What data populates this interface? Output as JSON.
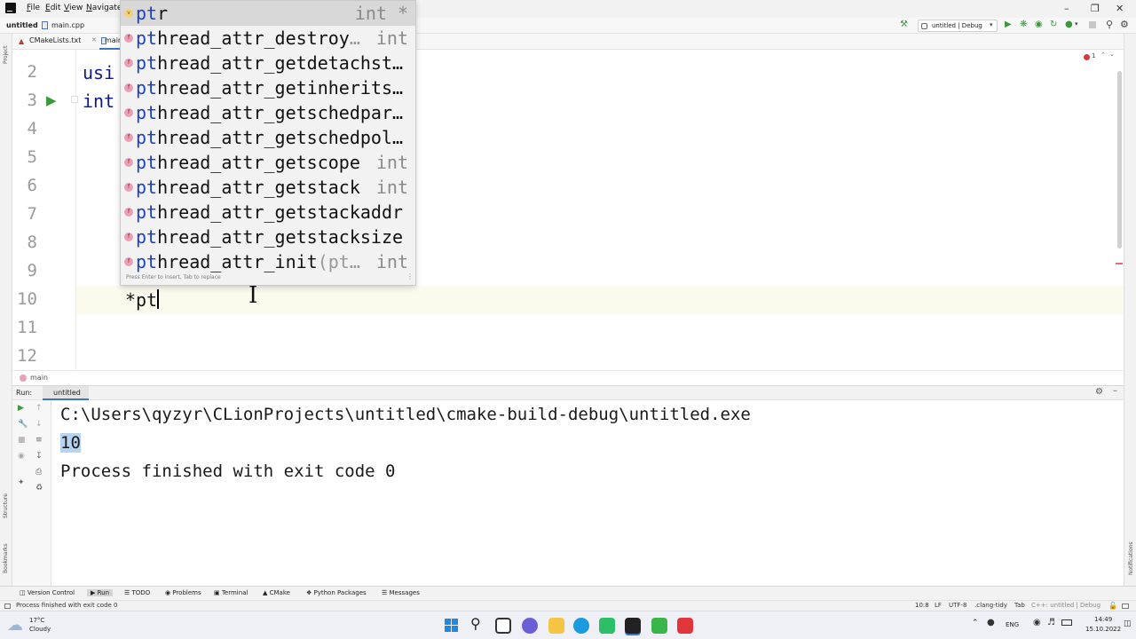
{
  "titlebar": {
    "menu": [
      "File",
      "Edit",
      "View",
      "Navigate"
    ],
    "window_controls": [
      "minimize-icon",
      "restore-icon",
      "close-icon"
    ]
  },
  "navbar": {
    "project": "untitled",
    "file": "main.cpp",
    "config": "untitled | Debug"
  },
  "tabs": [
    {
      "label": "CMakeLists.txt"
    },
    {
      "label": "main"
    }
  ],
  "inspection": {
    "count": "1"
  },
  "editor": {
    "lines": [
      {
        "number": "2",
        "code": "usi"
      },
      {
        "number": "3",
        "code": "int"
      },
      {
        "number": "4",
        "code": ""
      },
      {
        "number": "5",
        "code": ""
      },
      {
        "number": "6",
        "code": ""
      },
      {
        "number": "7",
        "code": ""
      },
      {
        "number": "8",
        "code": ""
      },
      {
        "number": "9",
        "code": ""
      },
      {
        "number": "10",
        "code": "*pt"
      },
      {
        "number": "11",
        "code": ""
      },
      {
        "number": "12",
        "code": ""
      }
    ]
  },
  "completion": {
    "typed": "pt",
    "items": [
      {
        "rest": "r",
        "hint": "",
        "type": "int *",
        "kind": "v"
      },
      {
        "rest": "hread_attr_destroy",
        "hint": "…",
        "type": "int",
        "kind": "f"
      },
      {
        "rest": "hread_attr_getdetachst…",
        "hint": "",
        "type": "",
        "kind": "f"
      },
      {
        "rest": "hread_attr_getinherits…",
        "hint": "",
        "type": "",
        "kind": "f"
      },
      {
        "rest": "hread_attr_getschedpar…",
        "hint": "",
        "type": "",
        "kind": "f"
      },
      {
        "rest": "hread_attr_getschedpol…",
        "hint": "",
        "type": "",
        "kind": "f"
      },
      {
        "rest": "hread_attr_getscope",
        "hint": "",
        "type": "int",
        "kind": "f"
      },
      {
        "rest": "hread_attr_getstack",
        "hint": "",
        "type": "int",
        "kind": "f"
      },
      {
        "rest": "hread_attr_getstackaddr",
        "hint": "",
        "type": "",
        "kind": "f"
      },
      {
        "rest": "hread_attr_getstacksize",
        "hint": "",
        "type": "",
        "kind": "f"
      },
      {
        "rest": "hread_attr_init",
        "hint": "(pt…",
        "type": "int",
        "kind": "f"
      }
    ],
    "footer": "Press Enter to insert, Tab to replace"
  },
  "breadcrumb": {
    "item": "main"
  },
  "run": {
    "label": "Run:",
    "tab": "untitled",
    "output": [
      "C:\\Users\\qyzyr\\CLionProjects\\untitled\\cmake-build-debug\\untitled.exe",
      "10",
      "",
      "Process finished with exit code 0"
    ]
  },
  "left_panels": [
    "Project",
    "Structure",
    "Bookmarks"
  ],
  "right_panels": [
    "Notifications"
  ],
  "tool_tabs": [
    "Version Control",
    "Run",
    "TODO",
    "Problems",
    "Terminal",
    "CMake",
    "Python Packages",
    "Messages"
  ],
  "status": {
    "message": "Process finished with exit code 0",
    "position": "10:8",
    "line_sep": "LF",
    "encoding": "UTF-8",
    "linter": ".clang-tidy",
    "indent": "Tab",
    "context": "C++: untitled | Debug"
  },
  "taskbar": {
    "weather_temp": "17°C",
    "weather_desc": "Cloudy",
    "lang": "ENG",
    "time": "14:49",
    "date": "15.10.2022"
  }
}
